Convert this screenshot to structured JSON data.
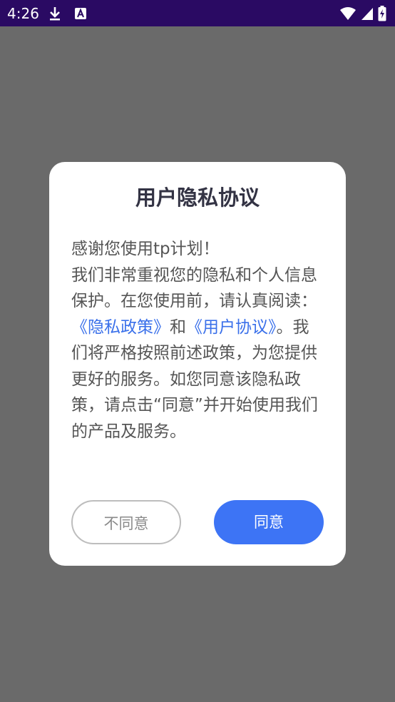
{
  "status_bar": {
    "time": "4:26",
    "icons": [
      "download-icon",
      "a-notification-icon",
      "wifi-icon",
      "signal-icon",
      "battery-icon"
    ]
  },
  "dialog": {
    "title": "用户隐私协议",
    "body": {
      "greeting": "感谢您使用tp计划！",
      "text1": "我们非常重视您的隐私和个人信息保护。在您使用前，请认真阅读：",
      "privacy_link": "《隐私政策》",
      "and": "和",
      "user_agreement_link": "《用户协议》",
      "text2": "。我们将严格按照前述政策，为您提供更好的服务。如您同意该隐私政策，请点击“同意”并开始使用我们的产品及服务。"
    },
    "buttons": {
      "disagree": "不同意",
      "agree": "同意"
    }
  },
  "colors": {
    "status_bar": "#2a0a63",
    "overlay": "#6a6a6a",
    "link": "#3a70ea",
    "primary_button": "#3d74f5"
  }
}
